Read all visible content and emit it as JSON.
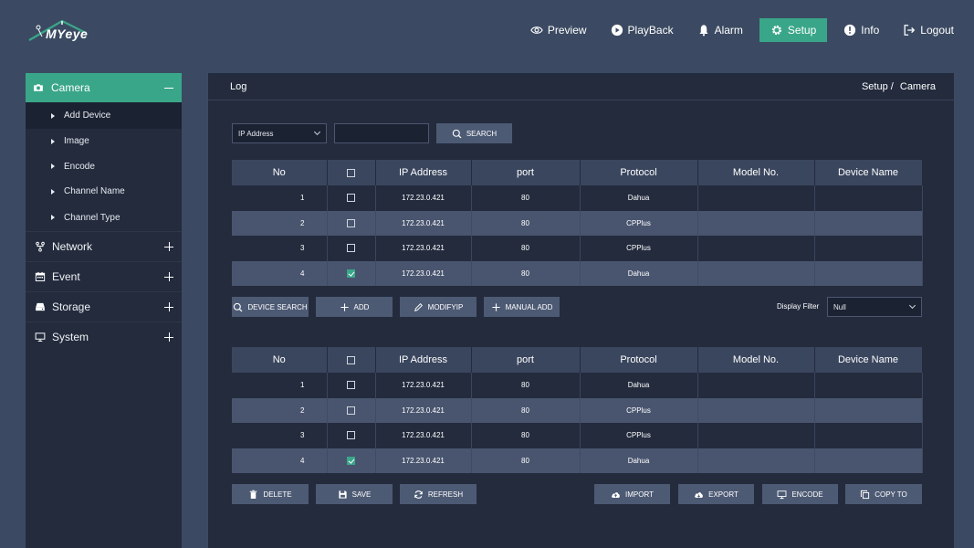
{
  "brand": {
    "logo_text": "MYeye",
    "accent": "#3aa689"
  },
  "nav": [
    {
      "label": "Preview",
      "icon": "eye-icon"
    },
    {
      "label": "PlayBack",
      "icon": "play-icon"
    },
    {
      "label": "Alarm",
      "icon": "bell-icon"
    },
    {
      "label": "Setup",
      "icon": "gear-icon",
      "active": true
    },
    {
      "label": "Info",
      "icon": "info-icon"
    },
    {
      "label": "Logout",
      "icon": "logout-icon"
    }
  ],
  "sidebar": {
    "camera": {
      "label": "Camera",
      "icon": "camera-icon"
    },
    "camera_items": [
      "Add  Device",
      "Image",
      "Encode",
      "Channel  Name",
      "Channel  Type"
    ],
    "groups": [
      {
        "label": "Network",
        "icon": "network-icon"
      },
      {
        "label": "Event",
        "icon": "calendar-icon"
      },
      {
        "label": "Storage",
        "icon": "storage-icon"
      },
      {
        "label": "System",
        "icon": "monitor-icon"
      }
    ]
  },
  "main": {
    "title": "Log",
    "breadcrumb": {
      "parent": "Setup /",
      "current": "Camera"
    }
  },
  "search": {
    "field_select": "IP  Address",
    "input_value": "",
    "button": "SEARCH"
  },
  "table_headers": [
    "No",
    "",
    "IP  Address",
    "port",
    "Protocol",
    "Model  No.",
    "Device  Name"
  ],
  "top_table": [
    {
      "no": "1",
      "checked": false,
      "ip": "172.23.0.421",
      "port": "80",
      "protocol": "Dahua",
      "model": "",
      "device": ""
    },
    {
      "no": "2",
      "checked": false,
      "ip": "172.23.0.421",
      "port": "80",
      "protocol": "CPPlus",
      "model": "",
      "device": ""
    },
    {
      "no": "3",
      "checked": false,
      "ip": "172.23.0.421",
      "port": "80",
      "protocol": "CPPlus",
      "model": "",
      "device": ""
    },
    {
      "no": "4",
      "checked": true,
      "ip": "172.23.0.421",
      "port": "80",
      "protocol": "Dahua",
      "model": "",
      "device": ""
    }
  ],
  "mid_actions": {
    "device_search": "DEVICE  SEARCH",
    "add": "ADD",
    "modify_ip": "MODIFYIP",
    "manual_add": "MANUAL  ADD",
    "display_filter_label": "Display  Filter",
    "display_filter_value": "Null"
  },
  "bottom_table": [
    {
      "no": "1",
      "checked": false,
      "ip": "172.23.0.421",
      "port": "80",
      "protocol": "Dahua",
      "model": "",
      "device": ""
    },
    {
      "no": "2",
      "checked": false,
      "ip": "172.23.0.421",
      "port": "80",
      "protocol": "CPPlus",
      "model": "",
      "device": ""
    },
    {
      "no": "3",
      "checked": false,
      "ip": "172.23.0.421",
      "port": "80",
      "protocol": "CPPlus",
      "model": "",
      "device": ""
    },
    {
      "no": "4",
      "checked": true,
      "ip": "172.23.0.421",
      "port": "80",
      "protocol": "Dahua",
      "model": "",
      "device": ""
    }
  ],
  "bottom_actions": {
    "delete": "DELETE",
    "save": "SAVE",
    "refresh": "REFRESH",
    "import": "IMPORT",
    "export": "EXPORT",
    "encode": "ENCODE",
    "copy_to": "COPY  TO"
  }
}
